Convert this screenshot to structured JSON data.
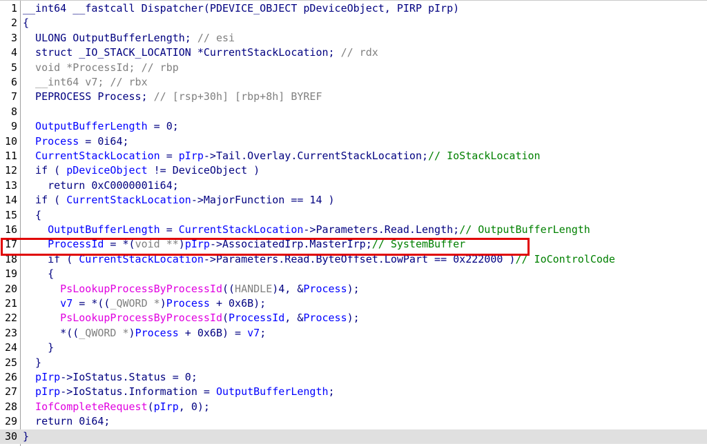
{
  "lines": [
    {
      "n": "1",
      "tokens": [
        [
          "k",
          "__int64 __fastcall Dispatcher(PDEVICE_OBJECT pDeviceObject, PIRP pIrp)"
        ]
      ]
    },
    {
      "n": "2",
      "tokens": [
        [
          "k",
          "{"
        ]
      ]
    },
    {
      "n": "3",
      "tokens": [
        [
          "k",
          "  ULONG OutputBufferLength; "
        ],
        [
          "cg",
          "// esi"
        ]
      ]
    },
    {
      "n": "4",
      "tokens": [
        [
          "k",
          "  struct _IO_STACK_LOCATION *CurrentStackLocation; "
        ],
        [
          "cg",
          "// rdx"
        ]
      ]
    },
    {
      "n": "5",
      "tokens": [
        [
          "g",
          "  void *ProcessId; "
        ],
        [
          "cg",
          "// rbp"
        ]
      ]
    },
    {
      "n": "6",
      "tokens": [
        [
          "g",
          "  __int64 v7; "
        ],
        [
          "cg",
          "// rbx"
        ]
      ]
    },
    {
      "n": "7",
      "tokens": [
        [
          "k",
          "  PEPROCESS Process; "
        ],
        [
          "cg",
          "// [rsp+30h] [rbp+8h] BYREF"
        ]
      ]
    },
    {
      "n": "8",
      "tokens": []
    },
    {
      "n": "9",
      "tokens": [
        [
          "v",
          "  OutputBufferLength"
        ],
        [
          "k",
          " = 0;"
        ]
      ]
    },
    {
      "n": "10",
      "tokens": [
        [
          "v",
          "  Process"
        ],
        [
          "k",
          " = 0i64;"
        ]
      ]
    },
    {
      "n": "11",
      "tokens": [
        [
          "v",
          "  CurrentStackLocation"
        ],
        [
          "k",
          " = "
        ],
        [
          "v",
          "pIrp"
        ],
        [
          "k",
          "->Tail.Overlay.CurrentStackLocation;"
        ],
        [
          "c",
          "// IoStackLocation"
        ]
      ]
    },
    {
      "n": "12",
      "tokens": [
        [
          "k",
          "  if ( "
        ],
        [
          "v",
          "pDeviceObject"
        ],
        [
          "k",
          " != DeviceObject )"
        ]
      ]
    },
    {
      "n": "13",
      "tokens": [
        [
          "k",
          "    return 0xC0000001i64;"
        ]
      ]
    },
    {
      "n": "14",
      "tokens": [
        [
          "k",
          "  if ( "
        ],
        [
          "v",
          "CurrentStackLocation"
        ],
        [
          "k",
          "->MajorFunction == 14 )"
        ]
      ]
    },
    {
      "n": "15",
      "tokens": [
        [
          "k",
          "  {"
        ]
      ]
    },
    {
      "n": "16",
      "tokens": [
        [
          "v",
          "    OutputBufferLength"
        ],
        [
          "k",
          " = "
        ],
        [
          "v",
          "CurrentStackLocation"
        ],
        [
          "k",
          "->Parameters.Read.Length;"
        ],
        [
          "c",
          "// OutputBufferLength"
        ]
      ]
    },
    {
      "n": "17",
      "tokens": [
        [
          "v",
          "    ProcessId"
        ],
        [
          "k",
          " = *("
        ],
        [
          "g",
          "void **"
        ],
        [
          "k",
          ")"
        ],
        [
          "v",
          "pIrp"
        ],
        [
          "k",
          "->AssociatedIrp.MasterIrp;"
        ],
        [
          "c",
          "// SystemBuffer"
        ]
      ]
    },
    {
      "n": "18",
      "tokens": [
        [
          "k",
          "    if ( "
        ],
        [
          "v",
          "CurrentStackLocation"
        ],
        [
          "k",
          "->Parameters.Read.ByteOffset.LowPart == 0x222000 )"
        ],
        [
          "c",
          "// IoControlCode"
        ]
      ]
    },
    {
      "n": "19",
      "tokens": [
        [
          "k",
          "    {"
        ]
      ]
    },
    {
      "n": "20",
      "tokens": [
        [
          "f",
          "      PsLookupProcessByProcessId"
        ],
        [
          "k",
          "(("
        ],
        [
          "g",
          "HANDLE"
        ],
        [
          "k",
          ")4, &"
        ],
        [
          "v",
          "Process"
        ],
        [
          "k",
          ");"
        ]
      ]
    },
    {
      "n": "21",
      "tokens": [
        [
          "v",
          "      v7"
        ],
        [
          "k",
          " = *(("
        ],
        [
          "g",
          "_QWORD *"
        ],
        [
          "k",
          ")"
        ],
        [
          "v",
          "Process"
        ],
        [
          "k",
          " + 0x6B);"
        ]
      ]
    },
    {
      "n": "22",
      "tokens": [
        [
          "f",
          "      PsLookupProcessByProcessId"
        ],
        [
          "k",
          "("
        ],
        [
          "v",
          "ProcessId"
        ],
        [
          "k",
          ", &"
        ],
        [
          "v",
          "Process"
        ],
        [
          "k",
          ");"
        ]
      ]
    },
    {
      "n": "23",
      "tokens": [
        [
          "k",
          "      *(("
        ],
        [
          "g",
          "_QWORD *"
        ],
        [
          "k",
          ")"
        ],
        [
          "v",
          "Process"
        ],
        [
          "k",
          " + 0x6B) = "
        ],
        [
          "v",
          "v7"
        ],
        [
          "k",
          ";"
        ]
      ]
    },
    {
      "n": "24",
      "tokens": [
        [
          "k",
          "    }"
        ]
      ]
    },
    {
      "n": "25",
      "tokens": [
        [
          "k",
          "  }"
        ]
      ]
    },
    {
      "n": "26",
      "tokens": [
        [
          "v",
          "  pIrp"
        ],
        [
          "k",
          "->IoStatus.Status = 0;"
        ]
      ]
    },
    {
      "n": "27",
      "tokens": [
        [
          "v",
          "  pIrp"
        ],
        [
          "k",
          "->IoStatus.Information = "
        ],
        [
          "v",
          "OutputBufferLength"
        ],
        [
          "k",
          ";"
        ]
      ]
    },
    {
      "n": "28",
      "tokens": [
        [
          "f",
          "  IofCompleteRequest"
        ],
        [
          "k",
          "("
        ],
        [
          "v",
          "pIrp"
        ],
        [
          "k",
          ", 0);"
        ]
      ]
    },
    {
      "n": "29",
      "tokens": [
        [
          "k",
          "  return 0i64;"
        ]
      ]
    },
    {
      "n": "30",
      "tokens": [
        [
          "k",
          "}"
        ]
      ]
    }
  ],
  "current_line": "30",
  "highlighted_line": "17",
  "colors": {
    "keyword": "#000080",
    "variable": "#0000ff",
    "comment": "#008000",
    "type_cast": "#808080",
    "function": "#e000e0",
    "highlight_box": "#e00000",
    "current_line_bg": "#e0e0e0"
  }
}
